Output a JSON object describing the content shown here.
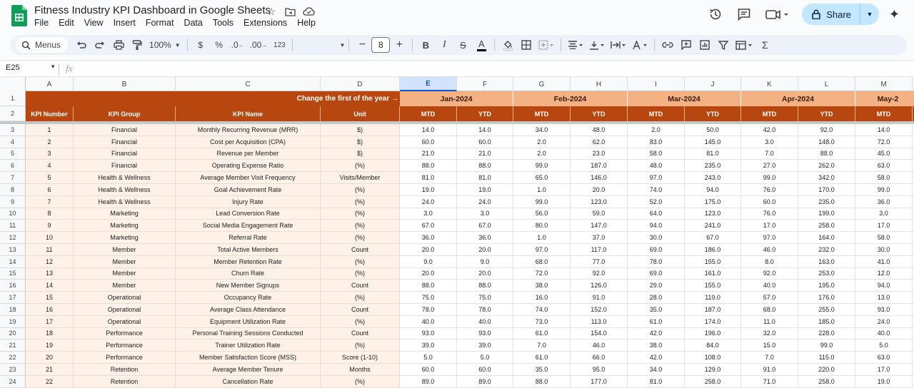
{
  "app": {
    "title": "Fitness Industry KPI Dashboard in Google Sheets",
    "menus": [
      "File",
      "Edit",
      "View",
      "Insert",
      "Format",
      "Data",
      "Tools",
      "Extensions",
      "Help"
    ],
    "share_label": "Share",
    "colors": {
      "accent_dark": "#b7470f",
      "accent_light": "#f4b183",
      "row_fill": "#fdf1e8",
      "share_bg": "#c2e7ff",
      "sheets_green": "#0f9d58"
    }
  },
  "toolbar": {
    "menus_search": "Menus",
    "zoom": "100%",
    "currency": "$",
    "percent": "%",
    "dec_decrease": ".0",
    "dec_increase": ".00",
    "number_format": "123",
    "font_size": "8"
  },
  "formula_bar": {
    "name_box": "E25",
    "fx": "fx"
  },
  "grid": {
    "columns": [
      {
        "letter": "A",
        "selected": false
      },
      {
        "letter": "B",
        "selected": false
      },
      {
        "letter": "C",
        "selected": false
      },
      {
        "letter": "D",
        "selected": false
      },
      {
        "letter": "E",
        "selected": true
      },
      {
        "letter": "F",
        "selected": false
      },
      {
        "letter": "G",
        "selected": false
      },
      {
        "letter": "H",
        "selected": false
      },
      {
        "letter": "I",
        "selected": false
      },
      {
        "letter": "J",
        "selected": false
      },
      {
        "letter": "K",
        "selected": false
      },
      {
        "letter": "L",
        "selected": false
      },
      {
        "letter": "M",
        "selected": false
      },
      {
        "letter": "",
        "selected": false
      }
    ],
    "header_note": "Change the first of the year →",
    "months": [
      "Jan-2024",
      "Feb-2024",
      "Mar-2024",
      "Apr-2024",
      "May-2"
    ],
    "subheaders": [
      "KPI Number",
      "KPI Group",
      "KPI Name",
      "Unit"
    ],
    "mtd": "MTD",
    "ytd": "YTD",
    "row_numbers": [
      "1",
      "2",
      "3",
      "4",
      "5",
      "6",
      "7",
      "8",
      "9",
      "10",
      "11",
      "12",
      "13",
      "14",
      "15",
      "16",
      "17",
      "18",
      "19",
      "20",
      "21",
      "22",
      "23",
      "24"
    ],
    "rows": [
      {
        "num": "1",
        "group": "Financial",
        "name": "Monthly Recurring Revenue (MRR)",
        "unit": "$)",
        "values": [
          "14.0",
          "14.0",
          "34.0",
          "48.0",
          "2.0",
          "50.0",
          "42.0",
          "92.0",
          "14.0"
        ]
      },
      {
        "num": "2",
        "group": "Financial",
        "name": "Cost per Acquisition (CPA)",
        "unit": "$)",
        "values": [
          "60.0",
          "60.0",
          "2.0",
          "62.0",
          "83.0",
          "145.0",
          "3.0",
          "148.0",
          "72.0"
        ]
      },
      {
        "num": "3",
        "group": "Financial",
        "name": "Revenue per Member",
        "unit": "$)",
        "values": [
          "21.0",
          "21.0",
          "2.0",
          "23.0",
          "58.0",
          "81.0",
          "7.0",
          "88.0",
          "45.0"
        ]
      },
      {
        "num": "4",
        "group": "Financial",
        "name": "Operating Expense Ratio",
        "unit": "(%)",
        "values": [
          "88.0",
          "88.0",
          "99.0",
          "187.0",
          "48.0",
          "235.0",
          "27.0",
          "262.0",
          "63.0"
        ]
      },
      {
        "num": "5",
        "group": "Health & Wellness",
        "name": "Average Member Visit Frequency",
        "unit": "Visits/Member",
        "values": [
          "81.0",
          "81.0",
          "65.0",
          "146.0",
          "97.0",
          "243.0",
          "99.0",
          "342.0",
          "58.0"
        ]
      },
      {
        "num": "6",
        "group": "Health & Wellness",
        "name": "Goal Achievement Rate",
        "unit": "(%)",
        "values": [
          "19.0",
          "19.0",
          "1.0",
          "20.0",
          "74.0",
          "94.0",
          "76.0",
          "170.0",
          "99.0"
        ]
      },
      {
        "num": "7",
        "group": "Health & Wellness",
        "name": "Injury Rate",
        "unit": "(%)",
        "values": [
          "24.0",
          "24.0",
          "99.0",
          "123.0",
          "52.0",
          "175.0",
          "60.0",
          "235.0",
          "36.0"
        ]
      },
      {
        "num": "8",
        "group": "Marketing",
        "name": "Lead Conversion Rate",
        "unit": "(%)",
        "values": [
          "3.0",
          "3.0",
          "56.0",
          "59.0",
          "64.0",
          "123.0",
          "76.0",
          "199.0",
          "3.0"
        ]
      },
      {
        "num": "9",
        "group": "Marketing",
        "name": "Social Media Engagement Rate",
        "unit": "(%)",
        "values": [
          "67.0",
          "67.0",
          "80.0",
          "147.0",
          "94.0",
          "241.0",
          "17.0",
          "258.0",
          "17.0"
        ]
      },
      {
        "num": "10",
        "group": "Marketing",
        "name": "Referral Rate",
        "unit": "(%)",
        "values": [
          "36.0",
          "36.0",
          "1.0",
          "37.0",
          "30.0",
          "67.0",
          "97.0",
          "164.0",
          "58.0"
        ]
      },
      {
        "num": "11",
        "group": "Member",
        "name": "Total Active Members",
        "unit": "Count",
        "values": [
          "20.0",
          "20.0",
          "97.0",
          "117.0",
          "69.0",
          "186.0",
          "46.0",
          "232.0",
          "30.0"
        ]
      },
      {
        "num": "12",
        "group": "Member",
        "name": "Member Retention Rate",
        "unit": "(%)",
        "values": [
          "9.0",
          "9.0",
          "68.0",
          "77.0",
          "78.0",
          "155.0",
          "8.0",
          "163.0",
          "41.0"
        ]
      },
      {
        "num": "13",
        "group": "Member",
        "name": "Churn Rate",
        "unit": "(%)",
        "values": [
          "20.0",
          "20.0",
          "72.0",
          "92.0",
          "69.0",
          "161.0",
          "92.0",
          "253.0",
          "12.0"
        ]
      },
      {
        "num": "14",
        "group": "Member",
        "name": "New Member Signups",
        "unit": "Count",
        "values": [
          "88.0",
          "88.0",
          "38.0",
          "126.0",
          "29.0",
          "155.0",
          "40.0",
          "195.0",
          "94.0"
        ]
      },
      {
        "num": "15",
        "group": "Operational",
        "name": "Occupancy Rate",
        "unit": "(%)",
        "values": [
          "75.0",
          "75.0",
          "16.0",
          "91.0",
          "28.0",
          "119.0",
          "57.0",
          "176.0",
          "13.0"
        ]
      },
      {
        "num": "16",
        "group": "Operational",
        "name": "Average Class Attendance",
        "unit": "Count",
        "values": [
          "78.0",
          "78.0",
          "74.0",
          "152.0",
          "35.0",
          "187.0",
          "68.0",
          "255.0",
          "93.0"
        ]
      },
      {
        "num": "17",
        "group": "Operational",
        "name": "Equipment Utilization Rate",
        "unit": "(%)",
        "values": [
          "40.0",
          "40.0",
          "73.0",
          "113.0",
          "61.0",
          "174.0",
          "11.0",
          "185.0",
          "24.0"
        ]
      },
      {
        "num": "18",
        "group": "Performance",
        "name": "Personal Training Sessions Conducted",
        "unit": "Count",
        "values": [
          "93.0",
          "93.0",
          "61.0",
          "154.0",
          "42.0",
          "196.0",
          "32.0",
          "228.0",
          "40.0"
        ]
      },
      {
        "num": "19",
        "group": "Performance",
        "name": "Trainer Utilization Rate",
        "unit": "(%)",
        "values": [
          "39.0",
          "39.0",
          "7.0",
          "46.0",
          "38.0",
          "84.0",
          "15.0",
          "99.0",
          "5.0"
        ]
      },
      {
        "num": "20",
        "group": "Performance",
        "name": "Member Satisfaction Score (MSS)",
        "unit": "Score (1-10)",
        "values": [
          "5.0",
          "5.0",
          "61.0",
          "66.0",
          "42.0",
          "108.0",
          "7.0",
          "115.0",
          "63.0"
        ]
      },
      {
        "num": "21",
        "group": "Retention",
        "name": "Average Member Tenure",
        "unit": "Months",
        "values": [
          "60.0",
          "60.0",
          "35.0",
          "95.0",
          "34.0",
          "129.0",
          "91.0",
          "220.0",
          "17.0"
        ]
      },
      {
        "num": "22",
        "group": "Retention",
        "name": "Cancellation Rate",
        "unit": "(%)",
        "values": [
          "89.0",
          "89.0",
          "88.0",
          "177.0",
          "81.0",
          "258.0",
          "71.0",
          "258.0",
          "19.0"
        ]
      }
    ]
  }
}
